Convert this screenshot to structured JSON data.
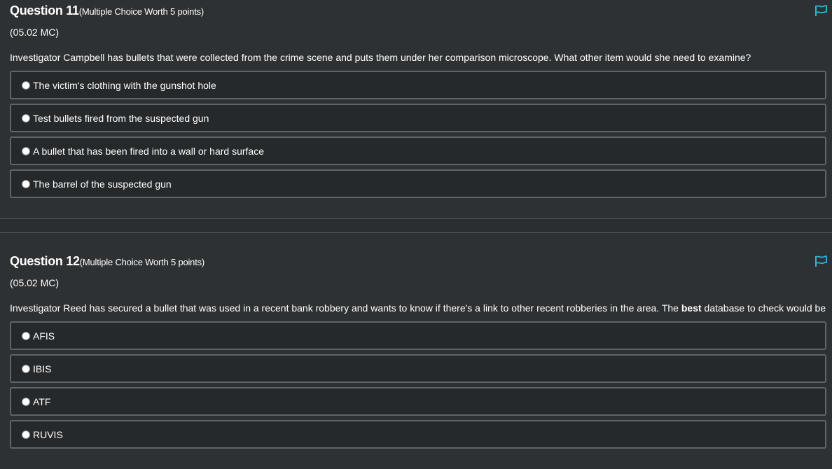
{
  "colors": {
    "background": "#2e3133",
    "option_background": "#26292b",
    "option_border": "#5f6466",
    "flag_color": "#2fb6d6",
    "text": "#ffffff"
  },
  "questions": [
    {
      "title": "Question 11",
      "points": "(Multiple Choice Worth 5 points)",
      "code": "(05.02 MC)",
      "prompt": "Investigator Campbell has bullets that were collected from the crime scene and puts them under her comparison microscope. What other item would she need to examine?",
      "flag_icon": "flag-icon",
      "options": [
        "The victim's clothing with the gunshot hole",
        "Test bullets fired from the suspected gun",
        "A bullet that has been fired into a wall or hard surface",
        "The barrel of the suspected gun"
      ]
    },
    {
      "title": "Question 12",
      "points": "(Multiple Choice Worth 5 points)",
      "code": "(05.02 MC)",
      "prompt_before": "Investigator Reed has secured a bullet that was used in a recent bank robbery and wants to know if there's a link to other recent robberies in the area. The ",
      "prompt_bold": "best",
      "prompt_after": " database to check would be",
      "flag_icon": "flag-icon",
      "options": [
        "AFIS",
        "IBIS",
        "ATF",
        "RUVIS"
      ]
    }
  ]
}
